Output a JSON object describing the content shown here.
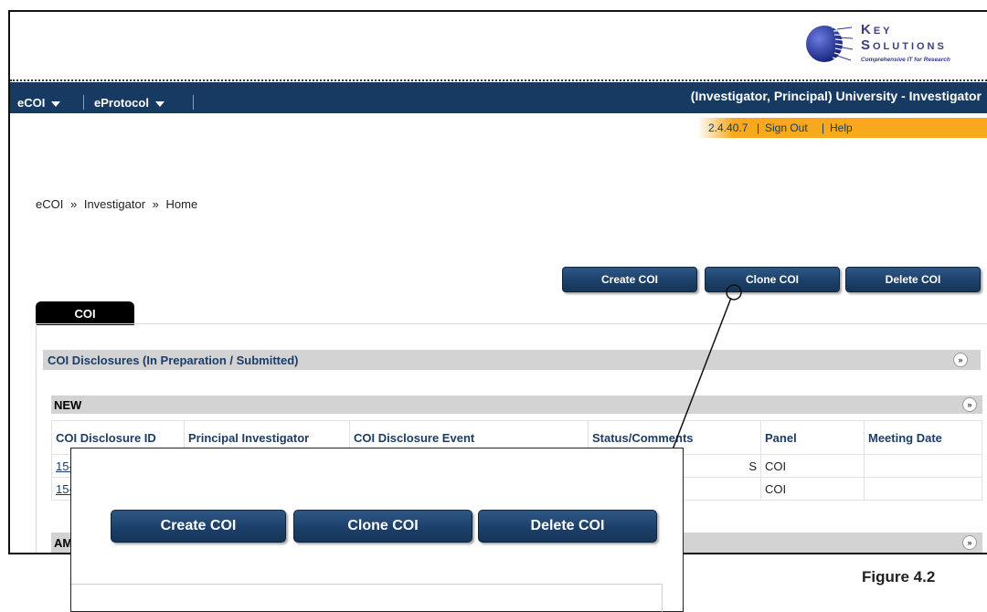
{
  "branding": {
    "logo_line1": "Key",
    "logo_line2": "Solutions",
    "logo_tagline": "Comprehensive IT for Research"
  },
  "nav": {
    "menus": [
      {
        "label": "eCOI"
      },
      {
        "label": "eProtocol"
      }
    ],
    "user_role": "(Investigator, Principal) University - Investigator"
  },
  "utility": {
    "version": "2.4.40.7",
    "sign_out": "Sign Out",
    "help": "Help",
    "separator": "|"
  },
  "breadcrumb": {
    "items": [
      "eCOI",
      "Investigator",
      "Home"
    ],
    "separator": "»"
  },
  "actions": {
    "create": "Create COI",
    "clone": "Clone COI",
    "delete": "Delete COI"
  },
  "tab": {
    "label": "COI"
  },
  "sections": {
    "disclosures_title": "COI Disclosures (In Preparation / Submitted)",
    "new_title": "NEW",
    "amend_title_partial": "AM"
  },
  "table": {
    "columns": [
      "COI Disclosure ID",
      "Principal Investigator",
      "COI Disclosure Event",
      "Status/Comments",
      "Panel",
      "Meeting Date"
    ],
    "rows": [
      {
        "id": "15-",
        "status": "S",
        "panel": "COI",
        "meeting_date": ""
      },
      {
        "id": "15-",
        "status": "",
        "panel": "COI",
        "meeting_date": ""
      }
    ]
  },
  "figure_label": "Figure 4.2",
  "colors": {
    "navbar": "#163a61",
    "button": "#1c406a",
    "accent_orange": "#f7a81d",
    "section_gray": "#d3d3d3"
  }
}
